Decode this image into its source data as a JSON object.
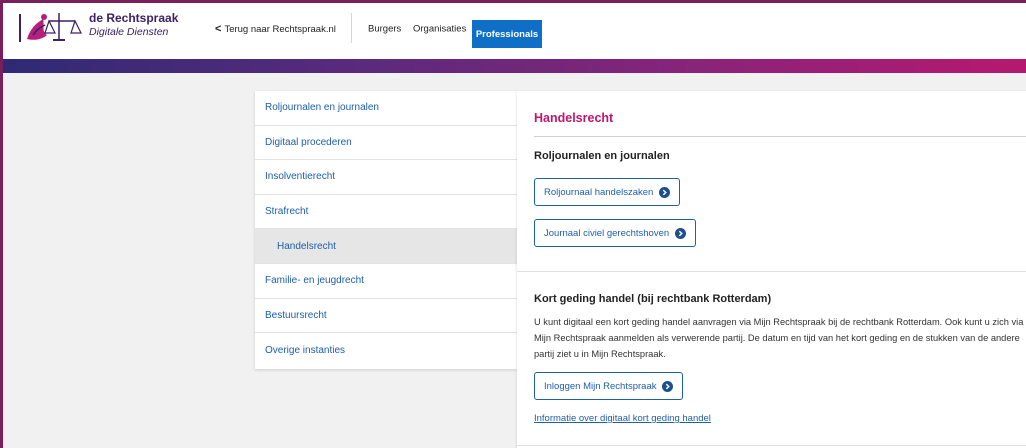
{
  "header": {
    "brand_title": "de Rechtspraak",
    "brand_subtitle": "Digitale Diensten",
    "back_link": "Terug naar Rechtspraak.nl",
    "nav": [
      {
        "label": "Burgers"
      },
      {
        "label": "Organisaties"
      },
      {
        "label": "Professionals",
        "active": true
      }
    ]
  },
  "colors": {
    "brand_purple": "#3b2166",
    "accent_magenta": "#c0156f",
    "primary_blue": "#0f6fc7",
    "link_blue": "#1d5fa8"
  },
  "sidebar": {
    "items": [
      {
        "label": "Roljournalen en journalen"
      },
      {
        "label": "Digitaal procederen"
      },
      {
        "label": "Insolventierecht"
      },
      {
        "label": "Strafrecht"
      },
      {
        "label": "Handelsrecht",
        "active": true
      },
      {
        "label": "Familie- en jeugdrecht"
      },
      {
        "label": "Bestuursrecht"
      },
      {
        "label": "Overige instanties"
      }
    ]
  },
  "main": {
    "title": "Handelsrecht",
    "sections": [
      {
        "heading": "Roljournalen en journalen",
        "buttons": [
          {
            "label": "Roljournaal handelszaken",
            "icon": "chevron-right-circle-icon"
          },
          {
            "label": "Journaal civiel gerechtshoven",
            "icon": "chevron-right-circle-icon"
          }
        ]
      },
      {
        "heading": "Kort geding handel (bij rechtbank Rotterdam)",
        "paragraph": "U kunt digitaal een kort geding handel aanvragen via Mijn Rechtspraak bij de rechtbank Rotterdam. Ook kunt u zich via Mijn Rechtspraak aanmelden als verwerende partij. De datum en tijd van het kort geding en de stukken van de andere partij ziet u in Mijn Rechtspraak.",
        "button": {
          "label": "Inloggen Mijn Rechtspraak",
          "icon": "chevron-right-circle-icon"
        },
        "link": "Informatie over digitaal kort geding handel"
      }
    ]
  }
}
